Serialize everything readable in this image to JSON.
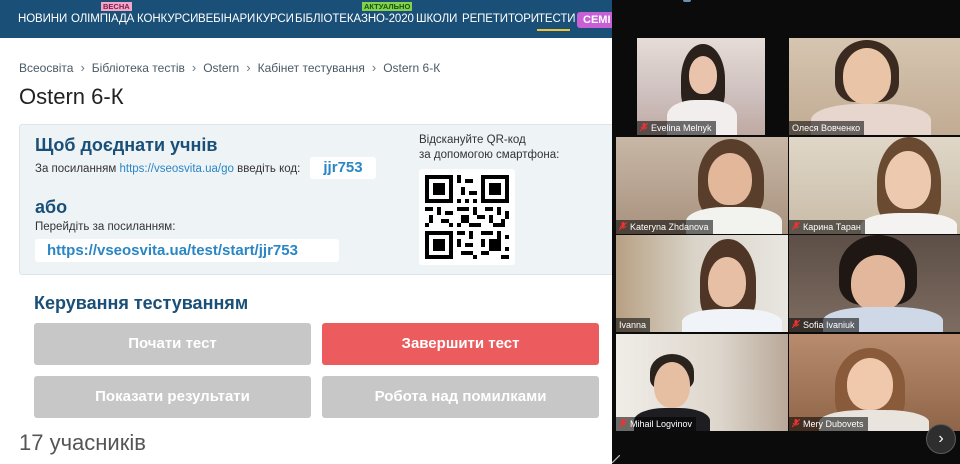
{
  "nav": {
    "items": [
      "НОВИНИ",
      "ОЛІМПІАДА",
      "КОНКУРСИ",
      "ВЕБІНАРИ",
      "КУРСИ",
      "БІБЛІОТЕКА",
      "ЗНО-2020",
      "ШКОЛИ",
      "РЕПЕТИТОРИ",
      "ТЕСТИ"
    ],
    "badge_spring": "ВЕСНА",
    "badge_actual": "АКТУАЛЬНО",
    "seminar": "СЕМІ",
    "active_item": "ТЕСТИ",
    "colors": {
      "bar": "#1a4f78",
      "underline": "#f2c230",
      "seminar": "#c760d6"
    }
  },
  "breadcrumb": [
    "Всеосвіта",
    "Бібліотека тестів",
    "Ostern",
    "Кабінет тестування",
    "Ostern 6-К"
  ],
  "page_title": "Ostern 6-К",
  "join": {
    "title": "Щоб доєднати учнів",
    "line_prefix": "За посиланням",
    "line_link": "https://vseosvita.ua/go",
    "line_suffix": "введіть код:",
    "code": "jjr753",
    "or_label": "або",
    "go_label": "Перейдіть за посиланням:",
    "full_link": "https://vseosvita.ua/test/start/jjr753",
    "qr_text_1": "Відскануйте QR-код",
    "qr_text_2": "за допомогою смартфона:"
  },
  "manage": {
    "title": "Керування тестуванням",
    "start_label": "Почати тест",
    "finish_label": "Завершити тест",
    "results_label": "Показати результати",
    "errors_label": "Робота над помилками"
  },
  "participants": "17 учасників",
  "video": {
    "tiles": [
      {
        "name": "Evelina Melnyk",
        "muted": true,
        "bg": "#d9cfd0"
      },
      {
        "name": "Олеся Вовченко",
        "muted": false,
        "bg": "#c9b8a5"
      },
      {
        "name": "Kateryna Zhdanova",
        "muted": true,
        "bg": "#b5a393"
      },
      {
        "name": "Карина Таран",
        "muted": true,
        "bg": "#d6cbb9"
      },
      {
        "name": "Ivanna",
        "muted": false,
        "bg": "#c8c0b2",
        "active_speaker": true
      },
      {
        "name": "Sofia Ivaniuk",
        "muted": true,
        "bg": "#6c5d55"
      },
      {
        "name": "Mihail Logvinov",
        "muted": true,
        "bg": "#d8d2c6"
      },
      {
        "name": "Mery Dubovets",
        "muted": true,
        "bg": "#a77c61"
      }
    ],
    "next_icon": "chevron-right-icon"
  }
}
